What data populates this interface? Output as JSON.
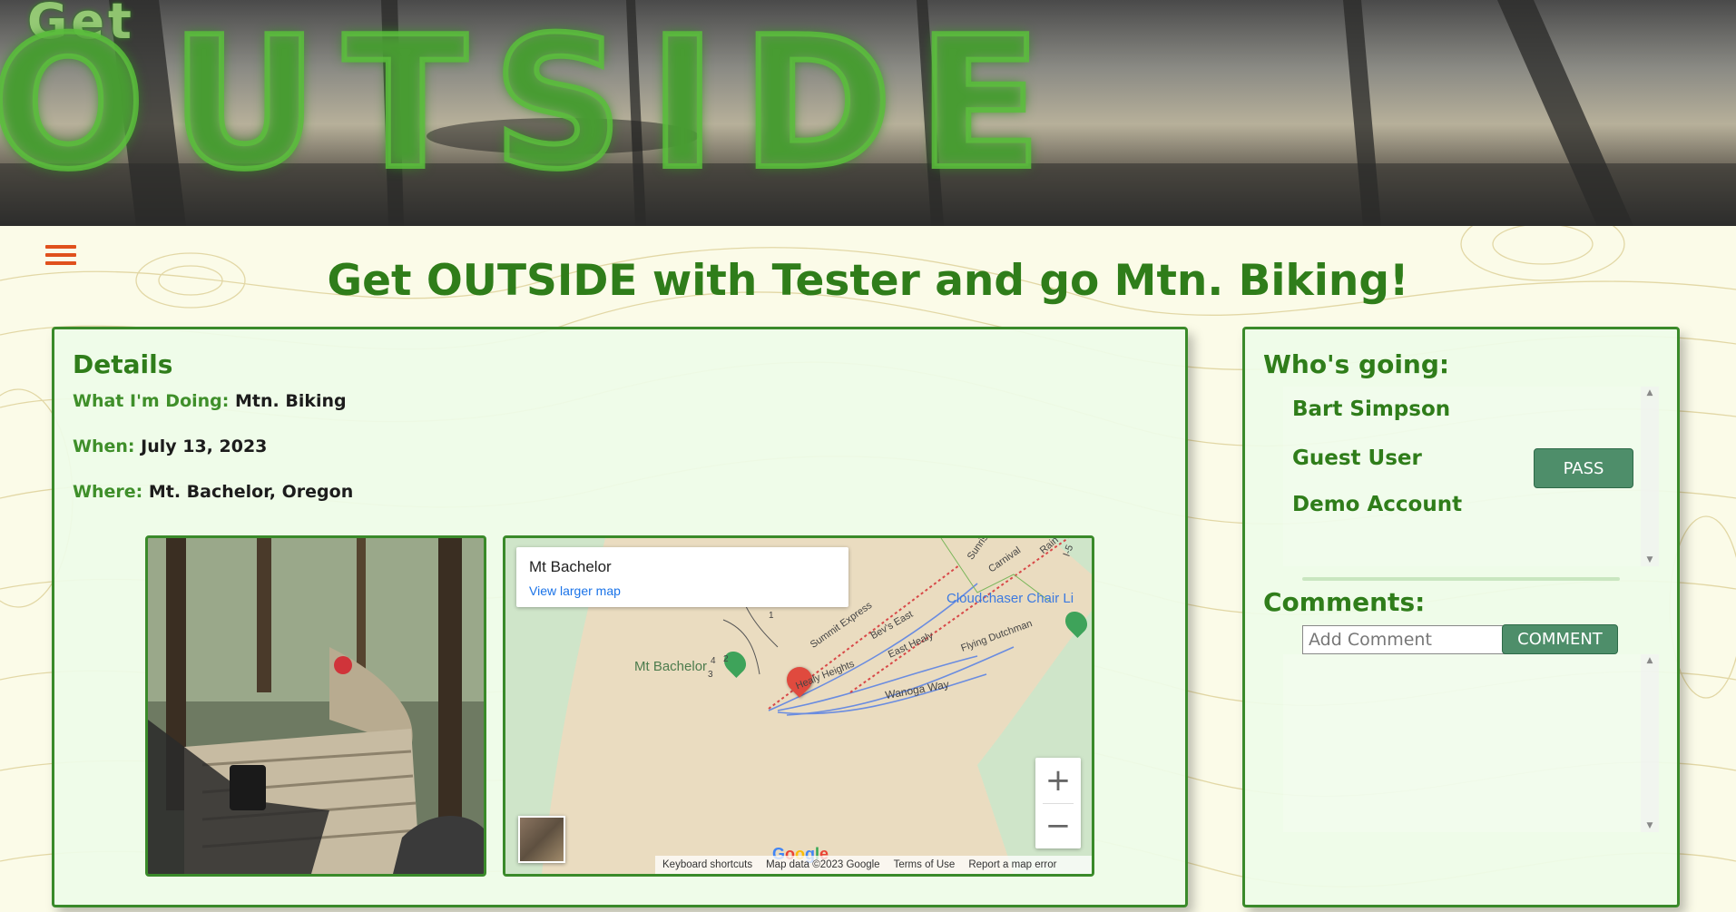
{
  "banner": {
    "small_text": "Get",
    "big_text": "OUTSIDE"
  },
  "header": {
    "title": "Get OUTSIDE with Tester and go Mtn. Biking!",
    "menu_icon": "hamburger-menu-icon"
  },
  "details": {
    "heading": "Details",
    "rows": [
      {
        "label": "What I'm Doing:",
        "value": "Mtn. Biking"
      },
      {
        "label": "When:",
        "value": "July 13, 2023"
      },
      {
        "label": "Where:",
        "value": "Mt. Bachelor, Oregon"
      }
    ]
  },
  "map": {
    "place_name": "Mt Bachelor",
    "view_larger": "View larger map",
    "zoom_in": "+",
    "zoom_out": "−",
    "google_logo": "Google",
    "labels": [
      "Mt Bachelor",
      "Summit Express",
      "Bev's East",
      "East Healy",
      "Healy Heights",
      "Wanoga Way",
      "Flying Dutchman",
      "Cloudchaser Chair Li",
      "Carnival",
      "Sunris",
      "Rain",
      "I-5",
      "1",
      "2",
      "3",
      "4"
    ],
    "footer": [
      "Keyboard shortcuts",
      "Map data ©2023 Google",
      "Terms of Use",
      "Report a map error"
    ]
  },
  "whos_going": {
    "heading": "Who's going:",
    "people": [
      "Bart Simpson",
      "Guest User",
      "Demo Account"
    ],
    "pass_label": "PASS"
  },
  "comments": {
    "heading": "Comments:",
    "placeholder": "Add Comment",
    "button_label": "COMMENT"
  },
  "colors": {
    "accent_green": "#2f7d1a",
    "button_green": "#4e8e6a",
    "menu_orange": "#e0501c",
    "panel_bg": "#eefce8"
  }
}
